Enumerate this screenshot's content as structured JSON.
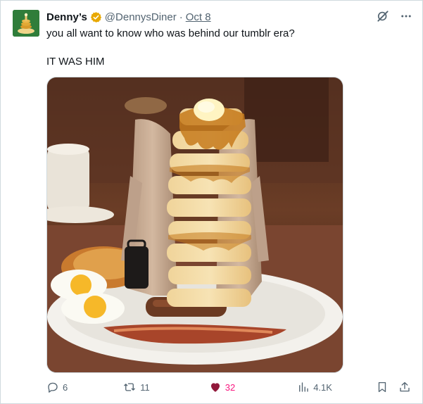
{
  "tweet": {
    "display_name": "Denny’s",
    "handle": "@DennysDiner",
    "separator": "·",
    "date": "Oct 8",
    "text_line1": "you all want to know who was behind our tumblr era?",
    "text_line2": "IT WAS HIM"
  },
  "actions": {
    "replies": "6",
    "retweets": "11",
    "likes": "32",
    "views": "4.1K"
  },
  "icons": {
    "verified": "verified-badge-icon",
    "grok": "grok-icon",
    "more": "more-options-icon",
    "reply": "reply-icon",
    "retweet": "retweet-icon",
    "like": "heart-icon",
    "views": "views-icon",
    "bookmark": "bookmark-icon",
    "share": "share-icon"
  },
  "colors": {
    "verified": "#e8a800",
    "like": "#f91880",
    "muted": "#536471"
  }
}
